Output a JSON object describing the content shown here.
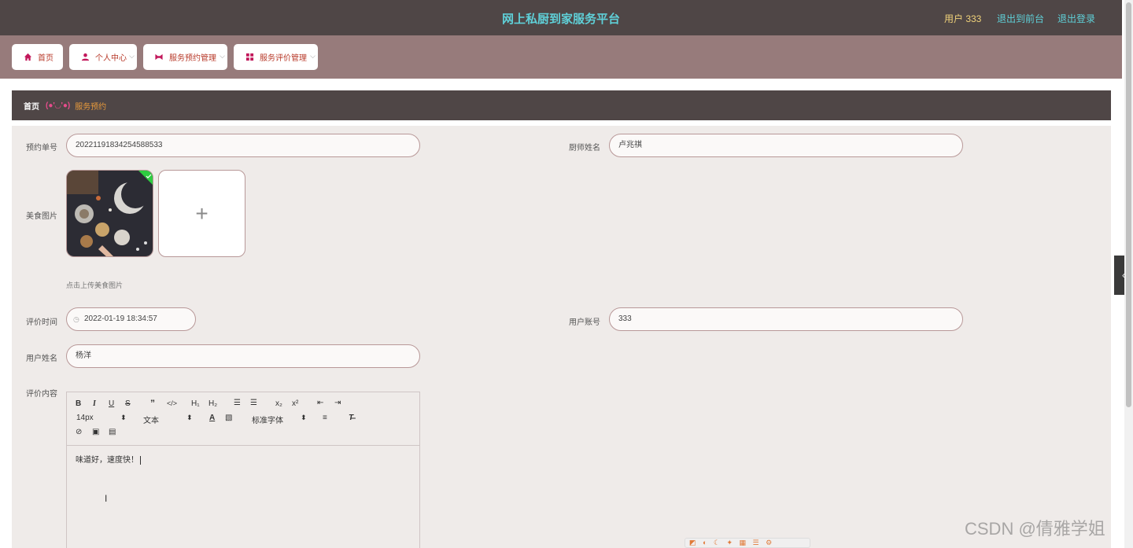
{
  "header": {
    "title": "网上私厨到家服务平台",
    "user_label": "用户 333",
    "links": [
      "退出到前台",
      "退出登录"
    ]
  },
  "nav": [
    {
      "label": "首页",
      "icon": "home-icon"
    },
    {
      "label": "个人中心",
      "icon": "person-icon"
    },
    {
      "label": "服务预约管理",
      "icon": "bowtie-icon"
    },
    {
      "label": "服务评价管理",
      "icon": "grid-icon"
    }
  ],
  "breadcrumb": {
    "home": "首页",
    "separator": "(●'◡'●)",
    "current": "服务预约"
  },
  "form": {
    "order_no": {
      "label": "预约单号",
      "value": "20221191834254588533"
    },
    "chef_name": {
      "label": "厨师姓名",
      "value": "卢兆祺"
    },
    "food_image": {
      "label": "美食图片",
      "hint": "点击上传美食图片",
      "upload_symbol": "+"
    },
    "review_time": {
      "label": "评价时间",
      "value": "2022-01-19 18:34:57"
    },
    "user_account": {
      "label": "用户账号",
      "value": "333"
    },
    "user_name": {
      "label": "用户姓名",
      "value": "杨洋"
    },
    "review_content": {
      "label": "评价内容",
      "value": "味道好，速度快！"
    }
  },
  "editor_toolbar": {
    "font_size": "14px",
    "block_type": "文本",
    "font_family": "标准字体"
  },
  "watermark": "CSDN @倩雅学姐",
  "colors": {
    "header_bg": "#4f4646",
    "nav_bg": "#977b7b",
    "title": "#5fd0d8",
    "accent": "#e89a3c",
    "panel_bg": "#efebe9"
  }
}
